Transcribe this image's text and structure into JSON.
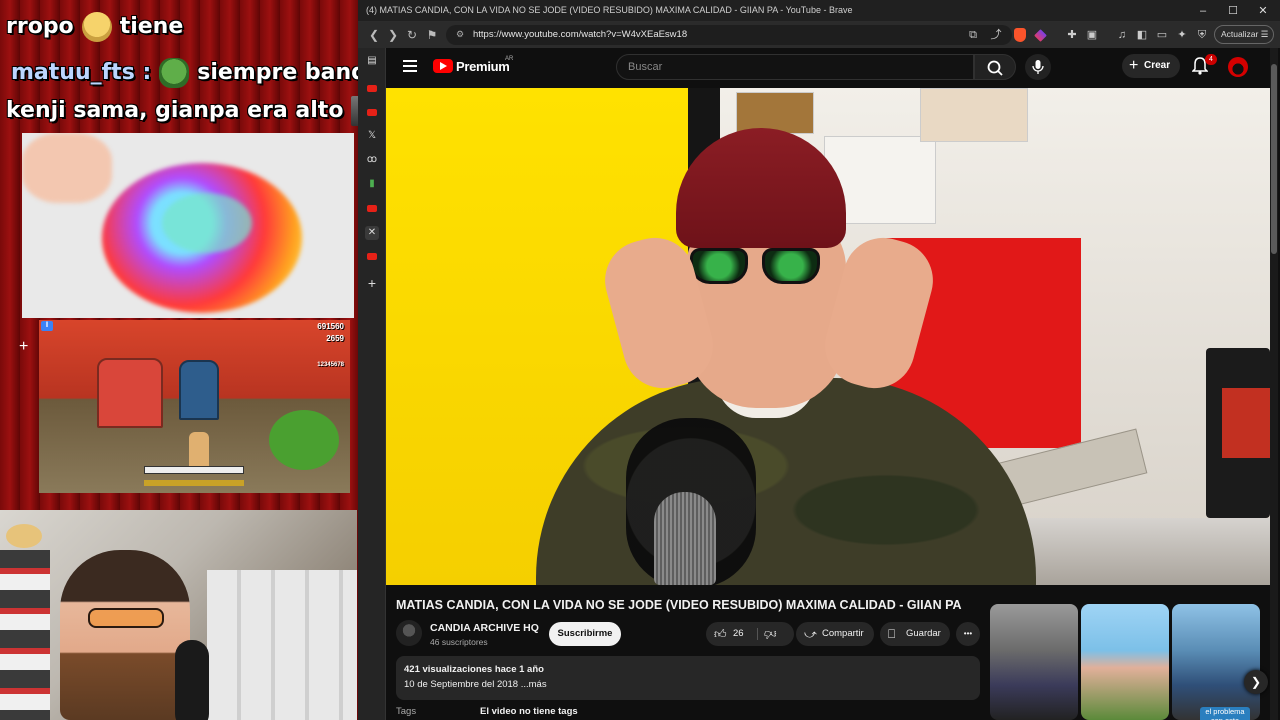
{
  "overlay": {
    "chat_line_1": "rropo",
    "chat_line_1_b": "tiene",
    "chat_user": "matuu_fts :",
    "chat_line_2": "siempre banque a",
    "chat_line_3": "kenji sama, gianpa era alto",
    "game_hud_score": "691560",
    "game_hud_coins": "2659",
    "game_hud_extra": "12345678"
  },
  "browser": {
    "window_title": "(4) MATIAS CANDIA, CON LA VIDA NO SE JODE (VIDEO RESUBIDO) MAXIMA CALIDAD - GIIAN PA - YouTube - Brave",
    "url": "https://www.youtube.com/watch?v=W4vXEaEsw18",
    "update_label": "Actualizar",
    "minimize": "–",
    "maximize": "☐",
    "close": "✕"
  },
  "youtube": {
    "logo_text": "Premium",
    "country_code": "AR",
    "search_placeholder": "Buscar",
    "create_label": "Crear",
    "notification_count": "4",
    "video_title": "MATIAS CANDIA, CON LA VIDA NO SE JODE (VIDEO RESUBIDO) MAXIMA CALIDAD - GIIAN PA",
    "channel_name": "CANDIA ARCHIVE HQ",
    "subscribers": "46 suscriptores",
    "subscribe_label": "Suscribirme",
    "like_count": "26",
    "share_label": "Compartir",
    "save_label": "Guardar",
    "more_label": "•••",
    "views_line": "421 visualizaciones  hace 1 año",
    "date_line": "10 de Septiembre del 2018 ...más",
    "tags_label": "Tags",
    "tags_value": "El video no tiene tags",
    "short_caption": "el problema con esta"
  },
  "colors": {
    "brand_red": "#ff0000",
    "page_bg": "#0f0f0f",
    "pill_bg": "#272727"
  }
}
